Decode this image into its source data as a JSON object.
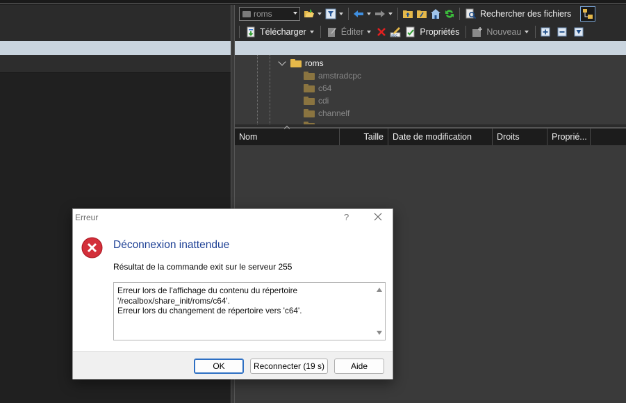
{
  "toolbar1": {
    "path_combo": "roms",
    "search_label": "Rechercher des fichiers"
  },
  "toolbar2": {
    "download_label": "Télécharger",
    "edit_label": "Éditer",
    "properties_label": "Propriétés",
    "new_label": "Nouveau"
  },
  "tree": {
    "root": "roms",
    "children": [
      "amstradcpc",
      "c64",
      "cdi",
      "channelf"
    ]
  },
  "file_list": {
    "columns": [
      "Nom",
      "Taille",
      "Date de modification",
      "Droits",
      "Proprié..."
    ]
  },
  "dialog": {
    "title": "Erreur",
    "help": "?",
    "heading": "Déconnexion inattendue",
    "message": "Résultat de la commande exit sur le serveur 255",
    "details": [
      "Erreur lors de l'affichage du contenu du répertoire",
      "'/recalbox/share_init/roms/c64'.",
      "Erreur lors du changement de répertoire vers 'c64'."
    ],
    "buttons": {
      "ok": "OK",
      "reconnect": "Reconnecter (19 s)",
      "help": "Aide"
    }
  },
  "colors": {
    "heading": "#1c3f94",
    "error_red": "#d32f3a",
    "folder": "#e5b84a",
    "primary_button_border": "#2d6fc3"
  },
  "icons": [
    "folder-icon",
    "filter-icon",
    "back-arrow-icon",
    "forward-arrow-icon",
    "parent-folder-icon",
    "root-folder-icon",
    "home-icon",
    "refresh-icon",
    "search-files-icon",
    "download-icon",
    "edit-icon",
    "delete-icon",
    "rename-icon",
    "properties-icon",
    "new-icon",
    "add-icon",
    "remove-icon",
    "filter-select-icon",
    "error-icon",
    "close-icon"
  ]
}
